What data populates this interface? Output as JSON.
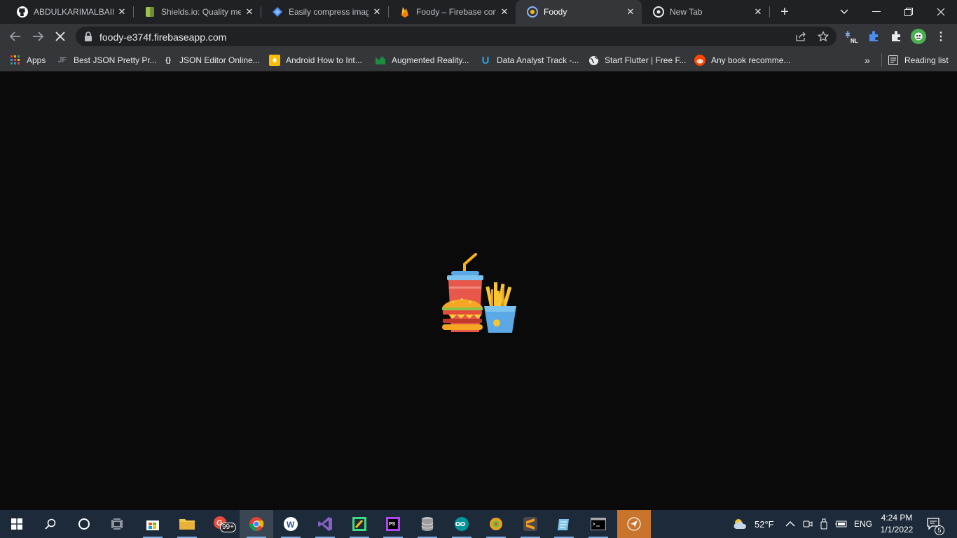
{
  "tabs": [
    {
      "title": "ABDULKARIMALBAIK/",
      "icon": "github-icon",
      "active": false
    },
    {
      "title": "Shields.io: Quality met",
      "icon": "shields-icon",
      "active": false
    },
    {
      "title": "Easily compress image",
      "icon": "compress-icon",
      "active": false
    },
    {
      "title": "Foody – Firebase cons",
      "icon": "firebase-icon",
      "active": false
    },
    {
      "title": "Foody",
      "icon": "foody-icon",
      "active": true
    },
    {
      "title": "New Tab",
      "icon": "chrome-icon",
      "active": false
    }
  ],
  "address_bar": {
    "url": "foody-e374f.firebaseapp.com"
  },
  "bookmarks": [
    {
      "label": "Apps",
      "icon": "apps-grid-icon"
    },
    {
      "label": "Best JSON Pretty Pr...",
      "icon": "jf-icon",
      "icon_text": "JF"
    },
    {
      "label": "JSON Editor Online...",
      "icon": "json-braces-icon",
      "icon_text": "{}"
    },
    {
      "label": "Android How to Int...",
      "icon": "android-bookmark-icon"
    },
    {
      "label": "Augmented Reality...",
      "icon": "coursera-icon"
    },
    {
      "label": "Data Analyst Track -...",
      "icon": "udacity-icon",
      "icon_text": "U"
    },
    {
      "label": "Start Flutter | Free F...",
      "icon": "globe-icon"
    },
    {
      "label": "Any book recomme...",
      "icon": "reddit-icon"
    }
  ],
  "reading_list": {
    "label": "Reading list"
  },
  "extensions": {
    "nl_badge": "NL"
  },
  "taskbar": {
    "notification_badge": "99+",
    "weather": "52°F",
    "language": "ENG",
    "time": "4:24 PM",
    "date": "1/1/2022",
    "action_center_count": "5"
  }
}
